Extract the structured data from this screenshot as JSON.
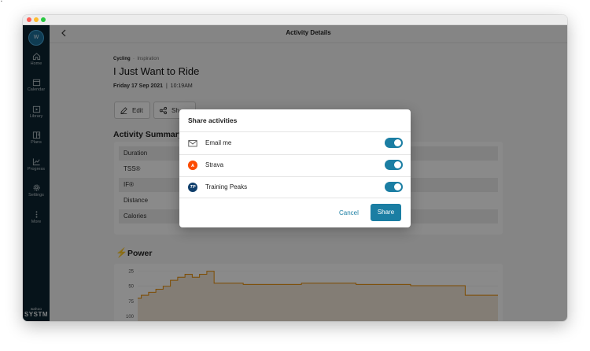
{
  "sidebar": {
    "avatar_initial": "W",
    "items": [
      {
        "label": "Home",
        "icon": "home-icon"
      },
      {
        "label": "Calendar",
        "icon": "calendar-icon"
      },
      {
        "label": "Library",
        "icon": "library-icon"
      },
      {
        "label": "Plans",
        "icon": "plans-icon"
      },
      {
        "label": "Progress",
        "icon": "progress-icon"
      },
      {
        "label": "Settings",
        "icon": "gear-icon"
      },
      {
        "label": "More",
        "icon": "more-icon"
      }
    ],
    "brand_small": "wahoo",
    "brand_big": "SYSTM"
  },
  "header": {
    "title": "Activity Details",
    "back_icon": "chevron-left-icon"
  },
  "activity": {
    "category": "Cycling",
    "subcategory": "Inspiration",
    "title": "I Just Want to Ride",
    "date": "Friday 17 Sep 2021",
    "time": "10:19AM",
    "edit_label": "Edit",
    "share_label": "Sh"
  },
  "summary": {
    "title": "Activity Summary",
    "rows": [
      "Duration",
      "TSS®",
      "IF®",
      "Distance",
      "Calories"
    ]
  },
  "power": {
    "title": "Power",
    "y_ticks": [
      "100",
      "75",
      "50",
      "25"
    ]
  },
  "chart_data": {
    "type": "line",
    "title": "Power",
    "ylim": [
      0,
      110
    ],
    "y_ticks": [
      25,
      50,
      75,
      100
    ],
    "series": [
      {
        "x": [
          0,
          1,
          2,
          3,
          4,
          5,
          6,
          7,
          8,
          9,
          10,
          11,
          12,
          13,
          14,
          15,
          16,
          17,
          18,
          19,
          20,
          21,
          22,
          23,
          24,
          25,
          26,
          27,
          28,
          29,
          30,
          31,
          32,
          33,
          34,
          35,
          36,
          37,
          38,
          39,
          40,
          41,
          42,
          43,
          44,
          45,
          46,
          47,
          48,
          49,
          50,
          51,
          52,
          53,
          54,
          55,
          56,
          57,
          58,
          59,
          60,
          61,
          62,
          63,
          64,
          65,
          66,
          67,
          68,
          69,
          70,
          71,
          72,
          73,
          74,
          75,
          76,
          77,
          78,
          79,
          80,
          81,
          82,
          83,
          84,
          85,
          86,
          87,
          88,
          89,
          90,
          91,
          92,
          93,
          94,
          95,
          96,
          97,
          98,
          99
        ],
        "values": [
          55,
          60,
          60,
          65,
          65,
          70,
          70,
          75,
          75,
          85,
          85,
          90,
          90,
          95,
          95,
          90,
          90,
          95,
          95,
          100,
          100,
          80,
          80,
          80,
          80,
          80,
          80,
          80,
          80,
          78,
          78,
          78,
          78,
          78,
          78,
          78,
          78,
          78,
          78,
          78,
          78,
          78,
          78,
          78,
          78,
          80,
          80,
          80,
          80,
          80,
          80,
          80,
          80,
          80,
          80,
          80,
          80,
          80,
          80,
          80,
          78,
          78,
          78,
          78,
          78,
          78,
          78,
          78,
          78,
          78,
          78,
          78,
          78,
          78,
          78,
          76,
          76,
          76,
          76,
          76,
          76,
          76,
          76,
          76,
          76,
          76,
          76,
          76,
          76,
          76,
          60,
          60,
          60,
          60,
          60,
          60,
          60,
          60,
          60,
          60
        ]
      }
    ]
  },
  "modal": {
    "title": "Share activities",
    "options": [
      {
        "label": "Email me",
        "icon": "mail-icon",
        "enabled": true
      },
      {
        "label": "Strava",
        "icon": "strava-icon",
        "enabled": true
      },
      {
        "label": "Training Peaks",
        "icon": "trainingpeaks-icon",
        "enabled": true
      }
    ],
    "tp_mark": "TP",
    "cancel_label": "Cancel",
    "share_label": "Share"
  },
  "colors": {
    "accent": "#1b7ea3",
    "sidebar": "#0c2430",
    "power_line": "#e88b00",
    "strava": "#fc4c02"
  }
}
